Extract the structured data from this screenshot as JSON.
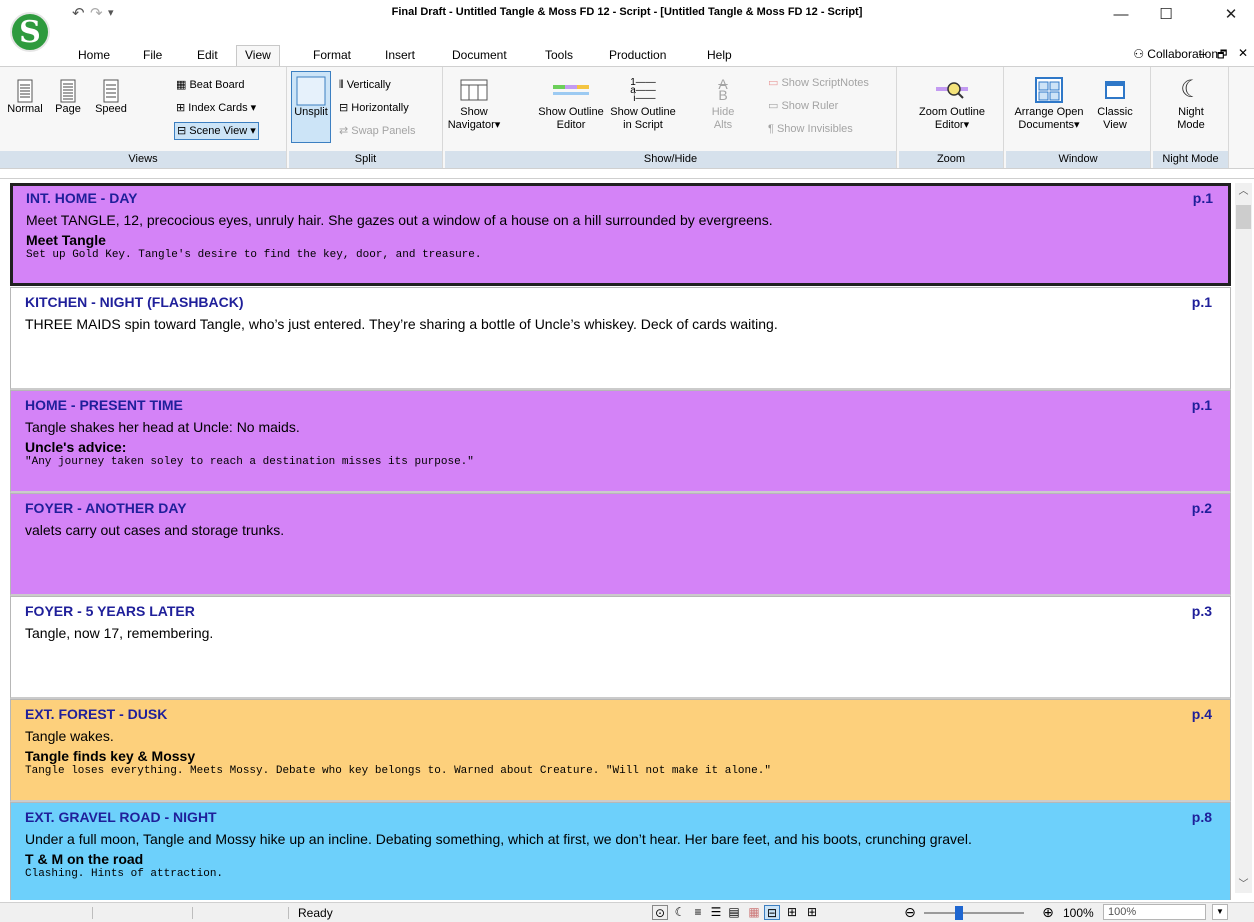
{
  "window": {
    "title": "Final Draft - Untitled Tangle & Moss FD 12 - Script - [Untitled Tangle & Moss FD 12 - Script]",
    "logo_glyph": "S",
    "undo_glyph": "↶",
    "redo_glyph": "↷",
    "qa_menu_glyph": "▾",
    "minimize_glyph": "—",
    "maximize_glyph": "☐",
    "close_glyph": "✕"
  },
  "tabs": [
    "Home",
    "File",
    "Edit",
    "View",
    "Format",
    "Insert",
    "Document",
    "Tools",
    "Production",
    "Help"
  ],
  "active_tab": "View",
  "collaboration": {
    "label": "Collaboration",
    "icon": "collaboration-icon"
  },
  "doc_controls": {
    "minimize": "–",
    "restore": "🗗",
    "close": "✕"
  },
  "ribbon": {
    "views": {
      "label": "Views",
      "normal": "Normal",
      "page": "Page",
      "speed": "Speed",
      "beat_board": "Beat Board",
      "index_cards": "Index Cards",
      "scene_view": "Scene View"
    },
    "split": {
      "label": "Split",
      "unsplit": "Unsplit",
      "vertically": "Vertically",
      "horizontally": "Horizontally",
      "swap_panels": "Swap Panels"
    },
    "show_hide": {
      "label": "Show/Hide",
      "show_navigator": [
        "Show",
        "Navigator"
      ],
      "show_outline_editor": [
        "Show Outline",
        "Editor"
      ],
      "show_outline_script": [
        "Show Outline",
        "in Script"
      ],
      "hide_alts": [
        "Hide",
        "Alts"
      ],
      "show_scriptnotes": "Show ScriptNotes",
      "show_ruler": "Show Ruler",
      "show_invisibles": "Show Invisibles"
    },
    "zoom": {
      "label": "Zoom",
      "zoom_outline_editor": [
        "Zoom Outline",
        "Editor"
      ]
    },
    "window": {
      "label": "Window",
      "arrange_open": [
        "Arrange Open",
        "Documents"
      ],
      "classic_view": [
        "Classic",
        "View"
      ]
    },
    "night_mode": {
      "label": "Night Mode",
      "button": [
        "Night",
        "Mode"
      ]
    }
  },
  "colors": {
    "purple": "#d483f7",
    "white": "#ffffff",
    "orange": "#fdd07c",
    "blue": "#6dd0fb"
  },
  "scenes": [
    {
      "heading": "INT. HOME - DAY",
      "page": "p.1",
      "color": "#d483f7",
      "selected": true,
      "body": "Meet TANGLE, 12, precocious eyes, unruly hair. She gazes out a window of a house on a hill surrounded by evergreens.",
      "summary_title": "Meet Tangle",
      "summary": "Set up Gold Key. Tangle's desire to find the key, door, and treasure."
    },
    {
      "heading": "KITCHEN - NIGHT (FLASHBACK)",
      "page": "p.1",
      "color": "#ffffff",
      "selected": false,
      "body": "THREE MAIDS spin toward Tangle, who’s just entered. They’re sharing a bottle of Uncle’s whiskey. Deck of cards waiting.",
      "summary_title": "",
      "summary": ""
    },
    {
      "heading": "HOME - PRESENT TIME",
      "page": "p.1",
      "color": "#d483f7",
      "selected": false,
      "body": "Tangle shakes her head at Uncle: No maids.",
      "summary_title": "Uncle's advice:",
      "summary": "\"Any journey taken soley to reach a destination misses its purpose.\""
    },
    {
      "heading": "FOYER - ANOTHER DAY",
      "page": "p.2",
      "color": "#d483f7",
      "selected": false,
      "body": "valets carry out cases and storage trunks.",
      "summary_title": "",
      "summary": ""
    },
    {
      "heading": "FOYER - 5 YEARS LATER",
      "page": "p.3",
      "color": "#ffffff",
      "selected": false,
      "body": "Tangle, now 17, remembering.",
      "summary_title": "",
      "summary": ""
    },
    {
      "heading": "EXT. FOREST - DUSK",
      "page": "p.4",
      "color": "#fdd07c",
      "selected": false,
      "body": "Tangle wakes.",
      "summary_title": "Tangle finds key & Mossy",
      "summary": "Tangle loses everything. Meets Mossy. Debate who key belongs to. Warned about Creature. \"Will not make it alone.\""
    },
    {
      "heading": "EXT. GRAVEL ROAD - NIGHT",
      "page": "p.8",
      "color": "#6dd0fb",
      "selected": false,
      "body": "Under a full moon, Tangle and Mossy hike up an incline. Debating something, which at first, we don’t hear. Her bare feet, and his boots, crunching gravel.",
      "summary_title": "T & M on the road",
      "summary": "Clashing. Hints of attraction."
    }
  ],
  "statusbar": {
    "status": "Ready",
    "zoom_percent": "100%",
    "zoom_value": "100%",
    "zoom_level": 0.35
  }
}
